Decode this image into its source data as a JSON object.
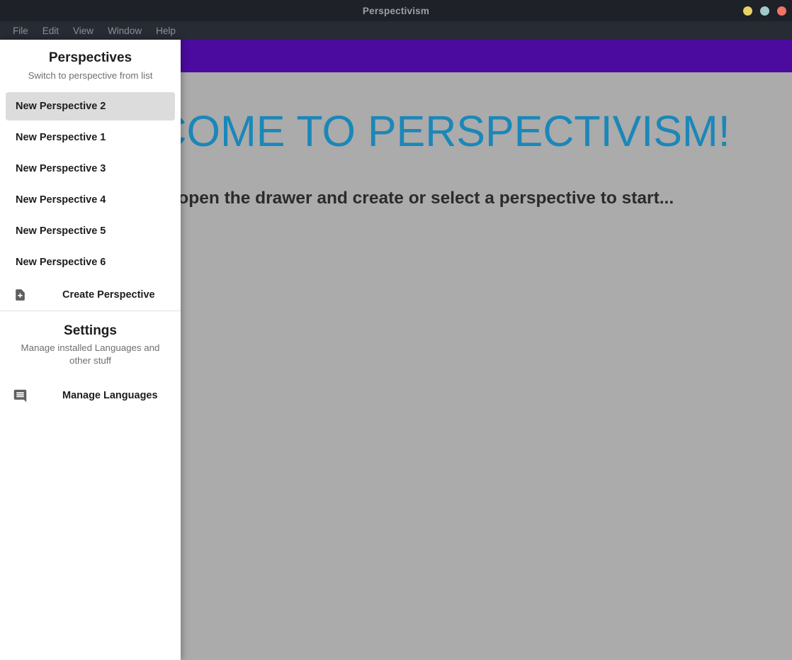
{
  "window": {
    "title": "Perspectivism",
    "controls": [
      {
        "name": "minimize-dot",
        "color": "#e8d264"
      },
      {
        "name": "maximize-dot",
        "color": "#9ecbc9"
      },
      {
        "name": "close-dot",
        "color": "#f07567"
      }
    ]
  },
  "menubar": {
    "items": [
      "File",
      "Edit",
      "View",
      "Window",
      "Help"
    ]
  },
  "appbar": {
    "color": "#4a0b9e",
    "title": ""
  },
  "content": {
    "title": "WELCOME TO PERSPECTIVISM!",
    "subtitle": "Please open the drawer and create or select a perspective to start...",
    "title_color": "#1b87b8",
    "background_color": "#ababab"
  },
  "drawer": {
    "perspectives": {
      "heading": "Perspectives",
      "subheading": "Switch to perspective from list",
      "items": [
        {
          "label": "New Perspective 2",
          "selected": true
        },
        {
          "label": "New Perspective 1",
          "selected": false
        },
        {
          "label": "New Perspective 3",
          "selected": false
        },
        {
          "label": "New Perspective 4",
          "selected": false
        },
        {
          "label": "New Perspective 5",
          "selected": false
        },
        {
          "label": "New Perspective 6",
          "selected": false
        }
      ],
      "create_action": {
        "label": "Create Perspective",
        "icon": "note-add-icon"
      }
    },
    "settings": {
      "heading": "Settings",
      "subheading": "Manage installed Languages and other stuff",
      "manage_languages_action": {
        "label": "Manage Languages",
        "icon": "comment-icon"
      }
    }
  }
}
